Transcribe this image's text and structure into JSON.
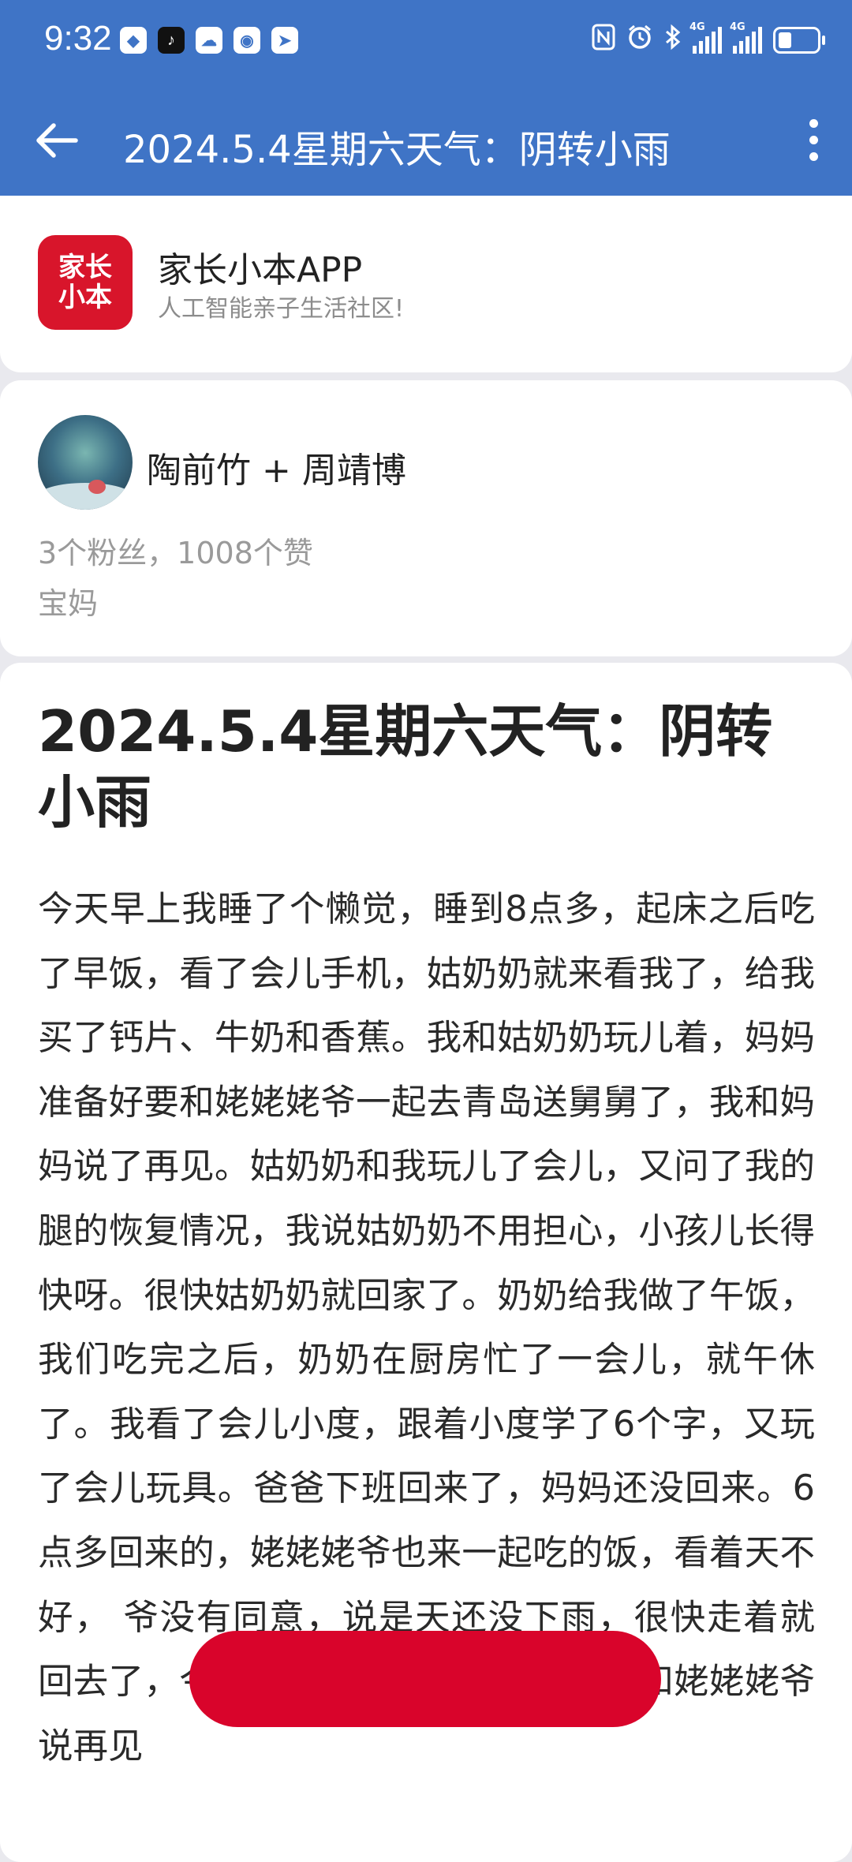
{
  "status_bar": {
    "time": "9:32",
    "apps": [
      {
        "icon": "shield-app-icon",
        "glyph": "◆"
      },
      {
        "icon": "tiktok-app-icon",
        "glyph": "♪"
      },
      {
        "icon": "cloud-app-icon",
        "glyph": "☁"
      },
      {
        "icon": "circle-app-icon",
        "glyph": "◉"
      },
      {
        "icon": "arrow-app-icon",
        "glyph": "➤"
      }
    ],
    "signal_label_1": "4G",
    "signal_label_2": "4G"
  },
  "app_bar": {
    "title": "2024.5.4星期六天气：阴转小雨"
  },
  "app_info": {
    "logo_line1": "家长",
    "logo_line2": "小本",
    "name": "家长小本APP",
    "slogan": "人工智能亲子生活社区!"
  },
  "author": {
    "name": "陶前竹 + 周靖博",
    "stats": "3个粉丝，1008个赞",
    "role": "宝妈"
  },
  "article": {
    "title": "2024.5.4星期六天气：阴转小雨",
    "body": "今天早上我睡了个懒觉，睡到8点多，起床之后吃了早饭，看了会儿手机，姑奶奶就来看我了，给我买了钙片、牛奶和香蕉。我和姑奶奶玩儿着，妈妈准备好要和姥姥姥爷一起去青岛送舅舅了，我和妈妈说了再见。姑奶奶和我玩儿了会儿，又问了我的腿的恢复情况，我说姑奶奶不用担心，小孩儿长得快呀。很快姑奶奶就回家了。奶奶给我做了午饭，我们吃完之后，奶奶在厨房忙了一会儿，就午休了。我看了会儿小度，跟着小度学了6个字，又玩了会儿玩具。爸爸下班回来了，妈妈还没回来。6点多回来的，姥姥姥爷也来一起吃的饭，看着天不好，                    爷没有同意，说是天还没下雨，很快走着就回去了，今天就不在这里住下了。我就和姥姥姥爷说再见"
  },
  "colors": {
    "header_blue": "#3f74c6",
    "brand_red": "#d8152b",
    "redaction_red": "#d9042b"
  }
}
